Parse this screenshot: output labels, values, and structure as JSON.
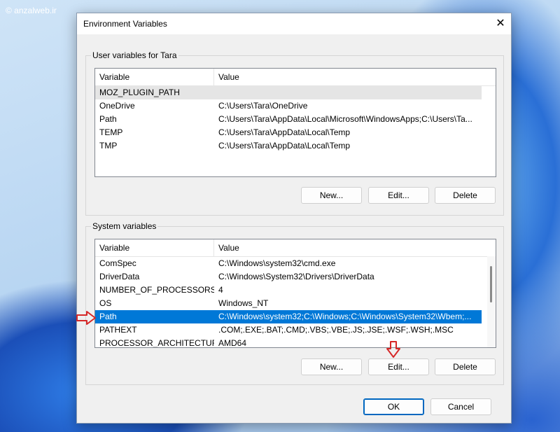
{
  "watermark": "© anzalweb.ir",
  "dialog": {
    "title": "Environment Variables",
    "close_glyph": "✕"
  },
  "user_vars": {
    "group_label": "User variables for Tara",
    "col_variable": "Variable",
    "col_value": "Value",
    "rows": [
      {
        "name": "MOZ_PLUGIN_PATH",
        "value": ""
      },
      {
        "name": "OneDrive",
        "value": "C:\\Users\\Tara\\OneDrive"
      },
      {
        "name": "Path",
        "value": "C:\\Users\\Tara\\AppData\\Local\\Microsoft\\WindowsApps;C:\\Users\\Ta..."
      },
      {
        "name": "TEMP",
        "value": "C:\\Users\\Tara\\AppData\\Local\\Temp"
      },
      {
        "name": "TMP",
        "value": "C:\\Users\\Tara\\AppData\\Local\\Temp"
      }
    ],
    "buttons": {
      "new": "New...",
      "edit": "Edit...",
      "delete": "Delete"
    }
  },
  "system_vars": {
    "group_label": "System variables",
    "col_variable": "Variable",
    "col_value": "Value",
    "rows": [
      {
        "name": "ComSpec",
        "value": "C:\\Windows\\system32\\cmd.exe"
      },
      {
        "name": "DriverData",
        "value": "C:\\Windows\\System32\\Drivers\\DriverData"
      },
      {
        "name": "NUMBER_OF_PROCESSORS",
        "value": "4"
      },
      {
        "name": "OS",
        "value": "Windows_NT"
      },
      {
        "name": "Path",
        "value": "C:\\Windows\\system32;C:\\Windows;C:\\Windows\\System32\\Wbem;..."
      },
      {
        "name": "PATHEXT",
        "value": ".COM;.EXE;.BAT;.CMD;.VBS;.VBE;.JS;.JSE;.WSF;.WSH;.MSC"
      },
      {
        "name": "PROCESSOR_ARCHITECTURE",
        "value": "AMD64"
      }
    ],
    "buttons": {
      "new": "New...",
      "edit": "Edit...",
      "delete": "Delete"
    }
  },
  "footer": {
    "ok": "OK",
    "cancel": "Cancel"
  },
  "colors": {
    "selection": "#0078d7",
    "annotation_arrow": "#d62828"
  }
}
